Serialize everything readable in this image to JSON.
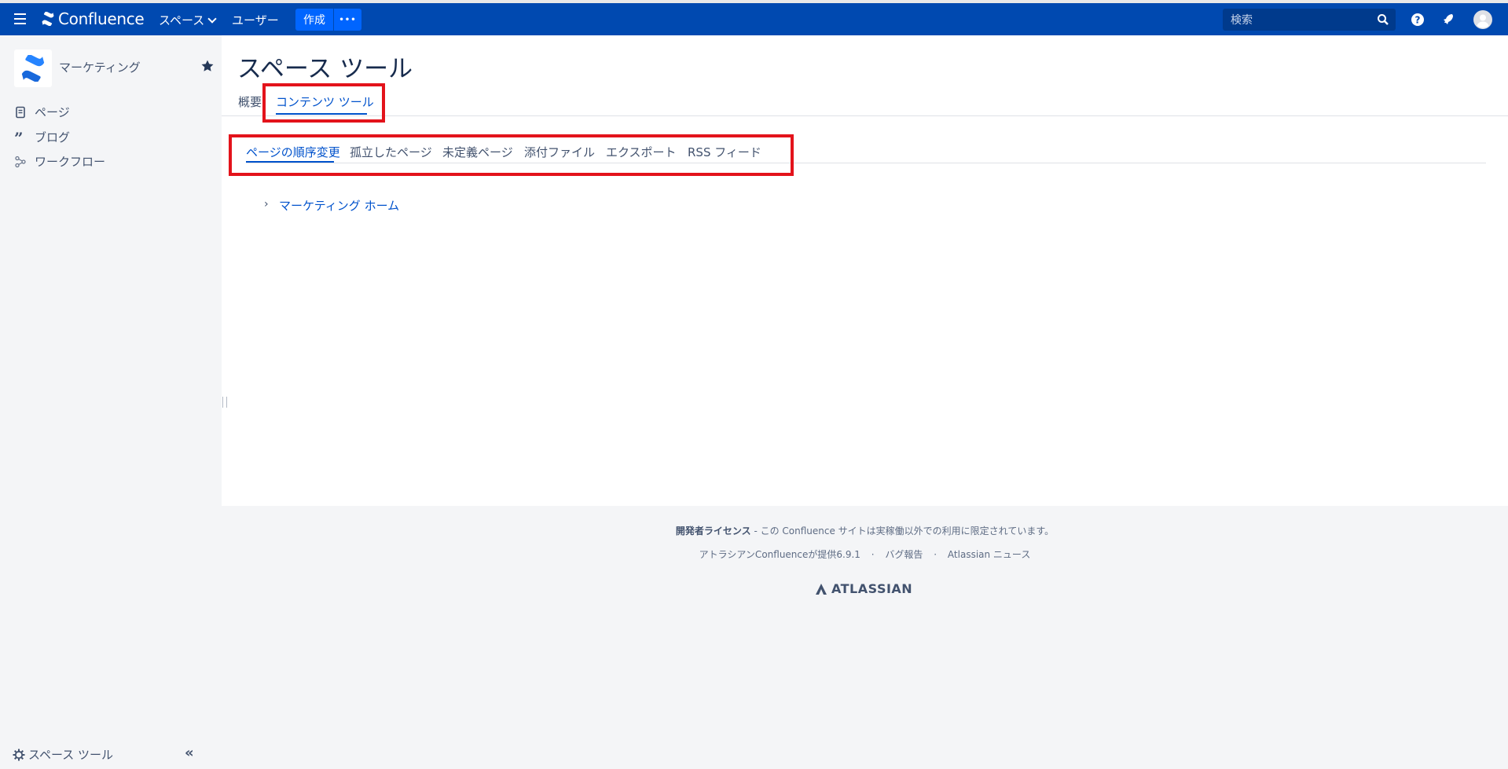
{
  "header": {
    "app_name": "Confluence",
    "nav_spaces": "スペース",
    "nav_users": "ユーザー",
    "create_label": "作成",
    "more_label": "•••",
    "search_placeholder": "検索",
    "brand_color": "#0049b0"
  },
  "sidebar": {
    "space_name": "マーケティング",
    "items": [
      {
        "label": "ページ",
        "icon": "page-icon"
      },
      {
        "label": "ブログ",
        "icon": "quote-icon"
      },
      {
        "label": "ワークフロー",
        "icon": "workflow-icon"
      }
    ],
    "footer_label": "スペース ツール",
    "collapse_label": "«"
  },
  "main": {
    "title": "スペース ツール",
    "tabs": [
      {
        "label": "概要"
      },
      {
        "label": "コンテンツ ツール",
        "active": true
      }
    ],
    "subtabs": [
      {
        "label": "ページの順序変更",
        "active": true
      },
      {
        "label": "孤立したページ"
      },
      {
        "label": "未定義ページ"
      },
      {
        "label": "添付ファイル"
      },
      {
        "label": "エクスポート"
      },
      {
        "label": "RSS フィード"
      }
    ],
    "tree": {
      "chevron": "›",
      "item": "マーケティング ホーム"
    }
  },
  "footer": {
    "license_bold": "開発者ライセンス",
    "license_text": " - この Confluence サイトは実稼働以外での利用に限定されています。",
    "powered": "アトラシアンConfluenceが提供6.9.1",
    "dot": "·",
    "bug_report": "バグ報告",
    "news": "Atlassian ニュース",
    "atlassian": "ATLASSIAN"
  },
  "colors": {
    "highlight": "#e3131b",
    "link": "#0052cc"
  }
}
